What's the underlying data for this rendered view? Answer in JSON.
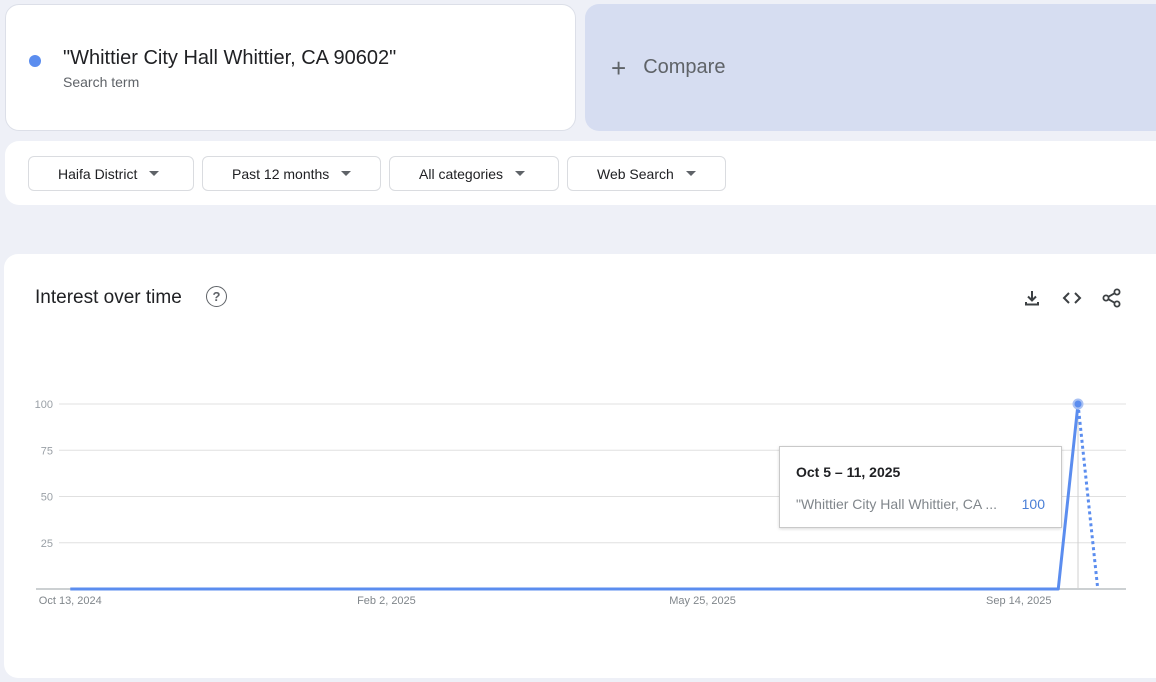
{
  "search_term": {
    "title": "\"Whittier City Hall Whittier, CA 90602\"",
    "subtitle": "Search term",
    "color": "#5b8def"
  },
  "compare": {
    "label": "Compare",
    "icon": "plus-icon"
  },
  "filters": [
    {
      "label": "Haifa District"
    },
    {
      "label": "Past 12 months"
    },
    {
      "label": "All categories"
    },
    {
      "label": "Web Search"
    }
  ],
  "interest_panel": {
    "title": "Interest over time",
    "help_icon": "help-circle-icon",
    "tools": [
      "download-icon",
      "embed-code-icon",
      "share-icon"
    ],
    "tooltip": {
      "date": "Oct 5 – 11, 2025",
      "term": "\"Whittier City Hall Whittier, CA ...",
      "value": "100"
    }
  },
  "chart_data": {
    "type": "line",
    "x_tick_labels": [
      "Oct 13, 2024",
      "Feb 2, 2025",
      "May 25, 2025",
      "Sep 14, 2025"
    ],
    "y_tick_labels": [
      "100",
      "75",
      "50",
      "25"
    ],
    "ylim": [
      0,
      100
    ],
    "grid": true,
    "series": [
      {
        "name": "\"Whittier City Hall Whittier, CA 90602\"",
        "color": "#5b8def",
        "x": [
          "2024-10-13",
          "2025-09-28",
          "2025-10-05"
        ],
        "values": [
          0,
          0,
          100
        ]
      }
    ],
    "partial_series": {
      "x": [
        "2025-10-05",
        "2025-10-12"
      ],
      "values": [
        100,
        0
      ],
      "style": "dotted"
    }
  }
}
